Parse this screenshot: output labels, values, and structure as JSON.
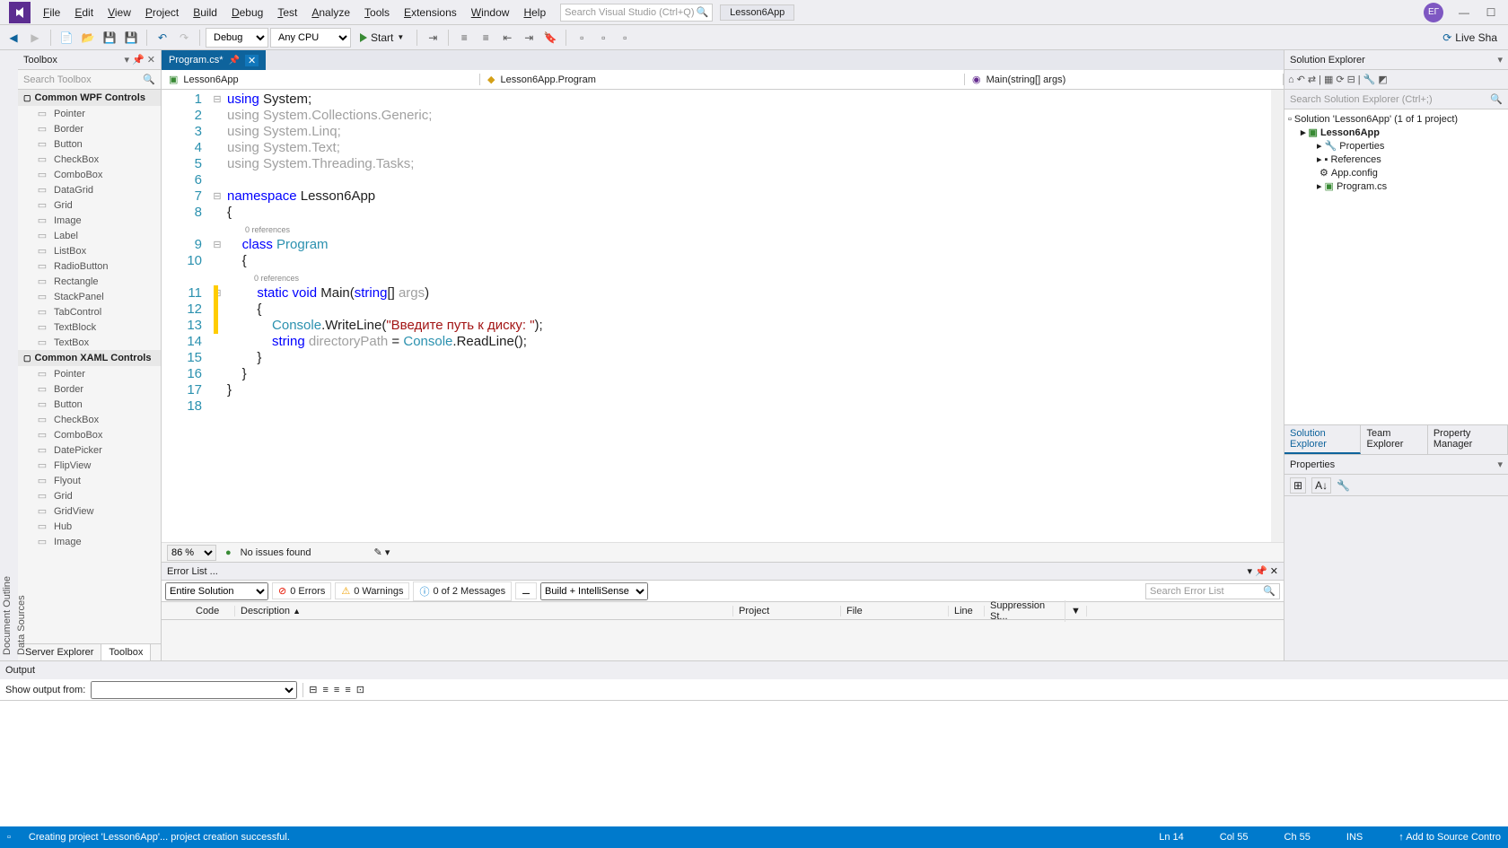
{
  "menubar": {
    "items": [
      "File",
      "Edit",
      "View",
      "Project",
      "Build",
      "Debug",
      "Test",
      "Analyze",
      "Tools",
      "Extensions",
      "Window",
      "Help"
    ],
    "search_placeholder": "Search Visual Studio (Ctrl+Q)",
    "app_title": "Lesson6App",
    "avatar_initials": "ЕГ"
  },
  "toolbar": {
    "config": "Debug",
    "platform": "Any CPU",
    "start": "Start",
    "liveshare": "Live Sha"
  },
  "left_vtabs": [
    "Document Outline",
    "Data Sources"
  ],
  "toolbox": {
    "title": "Toolbox",
    "search_placeholder": "Search Toolbox",
    "sections": [
      {
        "title": "Common WPF Controls",
        "items": [
          "Pointer",
          "Border",
          "Button",
          "CheckBox",
          "ComboBox",
          "DataGrid",
          "Grid",
          "Image",
          "Label",
          "ListBox",
          "RadioButton",
          "Rectangle",
          "StackPanel",
          "TabControl",
          "TextBlock",
          "TextBox"
        ]
      },
      {
        "title": "Common XAML Controls",
        "items": [
          "Pointer",
          "Border",
          "Button",
          "CheckBox",
          "ComboBox",
          "DatePicker",
          "FlipView",
          "Flyout",
          "Grid",
          "GridView",
          "Hub",
          "Image"
        ]
      }
    ],
    "bottom_tabs": [
      "Server Explorer",
      "Toolbox"
    ],
    "active_bottom_tab": 1
  },
  "doc_tab": {
    "name": "Program.cs*",
    "modified": true
  },
  "navbar": {
    "project": "Lesson6App",
    "class": "Lesson6App.Program",
    "method": "Main(string[] args)"
  },
  "code": {
    "lines": [
      {
        "n": 1,
        "t": [
          [
            "kw",
            "using"
          ],
          [
            "",
            " "
          ],
          [
            "",
            "System;"
          ]
        ]
      },
      {
        "n": 2,
        "t": [
          [
            "us-gray",
            "using System.Collections.Generic;"
          ]
        ]
      },
      {
        "n": 3,
        "t": [
          [
            "us-gray",
            "using System.Linq;"
          ]
        ]
      },
      {
        "n": 4,
        "t": [
          [
            "us-gray",
            "using System.Text;"
          ]
        ]
      },
      {
        "n": 5,
        "t": [
          [
            "us-gray",
            "using System.Threading.Tasks;"
          ]
        ]
      },
      {
        "n": 6,
        "t": [
          [
            "",
            ""
          ]
        ]
      },
      {
        "n": 7,
        "t": [
          [
            "kw",
            "namespace"
          ],
          [
            "",
            " Lesson6App"
          ]
        ]
      },
      {
        "n": 8,
        "t": [
          [
            "",
            "{"
          ]
        ]
      },
      {
        "n": 0,
        "t": [
          [
            "refs",
            "        0 references"
          ]
        ]
      },
      {
        "n": 9,
        "t": [
          [
            "",
            "    "
          ],
          [
            "kw",
            "class"
          ],
          [
            "",
            " "
          ],
          [
            "ty",
            "Program"
          ]
        ]
      },
      {
        "n": 10,
        "t": [
          [
            "",
            "    {"
          ]
        ]
      },
      {
        "n": 0,
        "t": [
          [
            "refs",
            "            0 references"
          ]
        ]
      },
      {
        "n": 11,
        "t": [
          [
            "",
            "        "
          ],
          [
            "kw",
            "static"
          ],
          [
            "",
            " "
          ],
          [
            "kw",
            "void"
          ],
          [
            "",
            " Main("
          ],
          [
            "kw",
            "string"
          ],
          [
            "",
            "[] "
          ],
          [
            "us-gray",
            "args"
          ],
          [
            "",
            ")"
          ]
        ]
      },
      {
        "n": 12,
        "t": [
          [
            "",
            "        {"
          ]
        ]
      },
      {
        "n": 13,
        "t": [
          [
            "",
            "            "
          ],
          [
            "ty",
            "Console"
          ],
          [
            "",
            ".WriteLine("
          ],
          [
            "str",
            "\"Введите путь к диску: \""
          ],
          [
            "",
            ");"
          ]
        ]
      },
      {
        "n": 14,
        "t": [
          [
            "",
            "            "
          ],
          [
            "kw",
            "string"
          ],
          [
            "",
            " "
          ],
          [
            "us-gray",
            "directoryPath"
          ],
          [
            "",
            " = "
          ],
          [
            "ty",
            "Console"
          ],
          [
            "",
            ".ReadLine();"
          ]
        ]
      },
      {
        "n": 15,
        "t": [
          [
            "",
            "        }"
          ]
        ]
      },
      {
        "n": 16,
        "t": [
          [
            "",
            "    }"
          ]
        ]
      },
      {
        "n": 17,
        "t": [
          [
            "",
            "}"
          ]
        ]
      },
      {
        "n": 18,
        "t": [
          [
            "",
            ""
          ]
        ]
      }
    ]
  },
  "editor_footer": {
    "zoom": "86 %",
    "issues": "No issues found"
  },
  "errorlist": {
    "title": "Error List ...",
    "scope": "Entire Solution",
    "errors": "0 Errors",
    "warnings": "0 Warnings",
    "messages": "0 of 2 Messages",
    "source": "Build + IntelliSense",
    "search_placeholder": "Search Error List",
    "cols": [
      "",
      "Code",
      "Description",
      "Project",
      "File",
      "Line",
      "Suppression St..."
    ]
  },
  "output": {
    "title": "Output",
    "show_from_label": "Show output from:"
  },
  "solution_explorer": {
    "title": "Solution Explorer",
    "search_placeholder": "Search Solution Explorer (Ctrl+;)",
    "root": "Solution 'Lesson6App' (1 of 1 project)",
    "project": "Lesson6App",
    "children": [
      "Properties",
      "References",
      "App.config",
      "Program.cs"
    ],
    "tabs": [
      "Solution Explorer",
      "Team Explorer",
      "Property Manager"
    ],
    "active_tab": 0
  },
  "properties": {
    "title": "Properties"
  },
  "statusbar": {
    "msg": "Creating project 'Lesson6App'... project creation successful.",
    "ln": "Ln 14",
    "col": "Col 55",
    "ch": "Ch 55",
    "ins": "INS",
    "src": "Add to Source Contro"
  }
}
